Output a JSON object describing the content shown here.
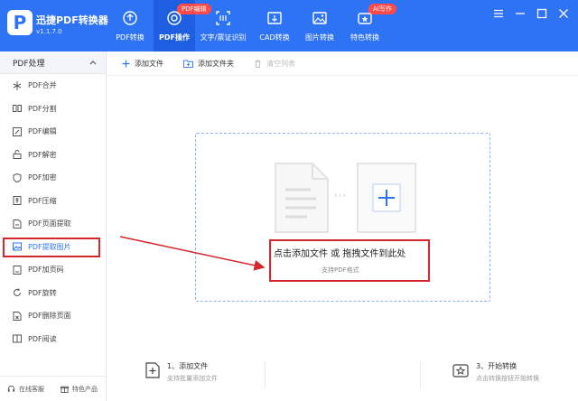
{
  "app": {
    "logo_letter": "P",
    "name": "迅捷PDF转换器",
    "version": "v1.1.7.0"
  },
  "nav": [
    {
      "label": "PDF转换",
      "icon": "refresh-icon",
      "badge": ""
    },
    {
      "label": "PDF操作",
      "icon": "target-icon",
      "badge": "PDF编辑"
    },
    {
      "label": "文字/票证识别",
      "icon": "scan-icon",
      "badge": ""
    },
    {
      "label": "CAD转换",
      "icon": "cad-icon",
      "badge": ""
    },
    {
      "label": "图片转换",
      "icon": "image-icon",
      "badge": ""
    },
    {
      "label": "特色转换",
      "icon": "star-icon",
      "badge": "AI写作"
    }
  ],
  "sidebar": {
    "header": "PDF处理",
    "items": [
      {
        "label": "PDF合并",
        "icon": "merge-icon"
      },
      {
        "label": "PDF分割",
        "icon": "split-icon"
      },
      {
        "label": "PDF编辑",
        "icon": "edit-icon"
      },
      {
        "label": "PDF解密",
        "icon": "unlock-icon"
      },
      {
        "label": "PDF加密",
        "icon": "shield-icon"
      },
      {
        "label": "PDF压缩",
        "icon": "compress-icon"
      },
      {
        "label": "PDF页面提取",
        "icon": "page-extract-icon"
      },
      {
        "label": "PDF提取图片",
        "icon": "image-extract-icon"
      },
      {
        "label": "PDF加页码",
        "icon": "page-number-icon"
      },
      {
        "label": "PDF旋转",
        "icon": "rotate-icon"
      },
      {
        "label": "PDF删除页面",
        "icon": "delete-page-icon"
      },
      {
        "label": "PDF阅读",
        "icon": "read-icon"
      }
    ],
    "bottom": {
      "service": "在线客服",
      "products": "特色产品"
    }
  },
  "toolbar": {
    "add_file": "添加文件",
    "add_folder": "添加文件夹",
    "clear_list": "清空列表"
  },
  "drop": {
    "title": "点击添加文件 或 拖拽文件到此处",
    "subtitle": "支持PDF格式",
    "arrows": "›››"
  },
  "steps": [
    {
      "title": "1、添加文件",
      "desc": "支持批量添加文件"
    },
    {
      "title": "3、开始转换",
      "desc": "点击转换按钮开始转换"
    }
  ],
  "colors": {
    "brand": "#2f73f5",
    "annotation": "#d6262e"
  }
}
